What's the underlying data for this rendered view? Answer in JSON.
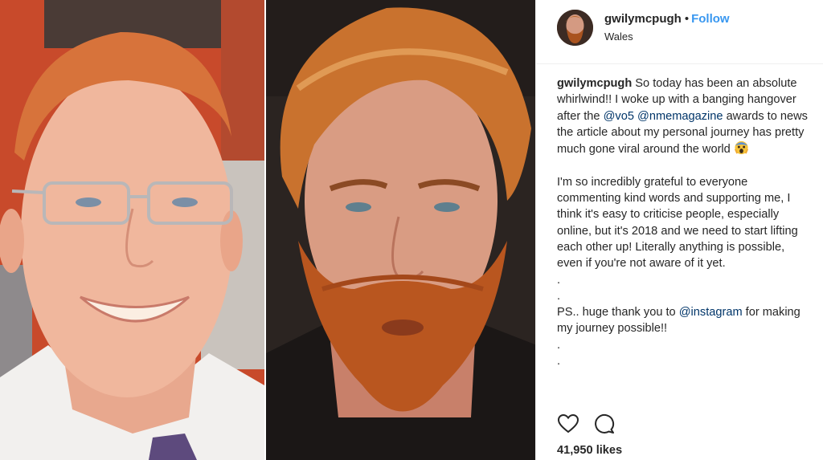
{
  "post": {
    "username": "gwilymcpugh",
    "separator": "•",
    "follow_label": "Follow",
    "location": "Wales"
  },
  "caption": {
    "username": "gwilymcpugh",
    "p1_text_a": " So today has been an absolute whirlwind!! I woke up with a banging hangover after the ",
    "mention_vo5": "@vo5",
    "p1_text_b": " ",
    "mention_nme": "@nmemagazine",
    "p1_text_c": " awards to news the article about my personal journey has pretty much gone viral around the world ",
    "emoji": "screaming-face-emoji",
    "p2_text": "I'm so incredibly grateful to everyone commenting kind words and supporting me, I think it's easy to criticise people, especially online, but it's 2018 and we need to start lifting each other up! Literally anything is possible, even if you're not aware of it yet.",
    "dot1": ".",
    "dot2": ".",
    "p3_text_a": "PS.. huge thank you to ",
    "mention_instagram": "@instagram",
    "p3_text_b": " for making my journey possible!!",
    "dot3": ".",
    "dot4": "."
  },
  "actions": {
    "like_icon": "heart-icon",
    "comment_icon": "comment-icon",
    "likes_count": "41,950 likes"
  },
  "colors": {
    "link_blue": "#3897f0",
    "mention_blue": "#003569",
    "text": "#262626",
    "divider": "#efefef"
  }
}
